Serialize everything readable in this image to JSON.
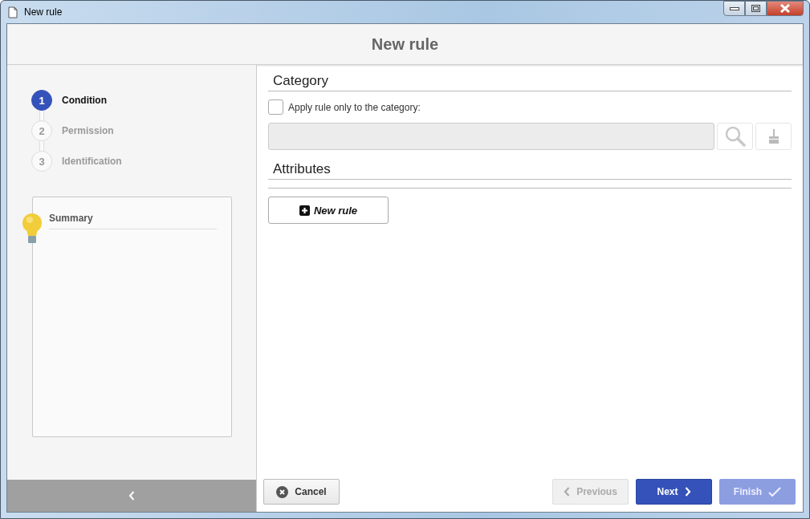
{
  "window": {
    "title": "New rule"
  },
  "header": {
    "title": "New rule"
  },
  "steps": [
    {
      "number": "1",
      "label": "Condition",
      "selected": true
    },
    {
      "number": "2",
      "label": "Permission",
      "selected": false
    },
    {
      "number": "3",
      "label": "Identification",
      "selected": false
    }
  ],
  "summary": {
    "title": "Summary"
  },
  "category": {
    "title": "Category",
    "checkbox": {
      "label": "Apply rule only to the category:",
      "checked": false
    }
  },
  "attributes": {
    "title": "Attributes",
    "new_rule_button": "New rule"
  },
  "footer": {
    "cancel": "Cancel",
    "buttons": [
      {
        "kind": "previous",
        "label": "Previous",
        "disabled": true
      },
      {
        "kind": "next",
        "label": "Next",
        "disabled": false
      },
      {
        "kind": "finish",
        "label": "Finish",
        "disabled": true
      }
    ]
  }
}
